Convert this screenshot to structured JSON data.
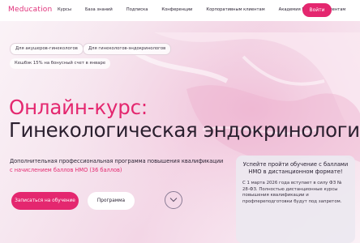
{
  "header": {
    "logo": "Meducation",
    "nav": [
      "Курсы",
      "База знаний",
      "Подписка",
      "Конференции",
      "Корпоративным клиентам",
      "Академия РТ",
      "Пациентам"
    ],
    "login_label": "Войти"
  },
  "tags": [
    "Для акушеров-гинекологов",
    "Для гинекологов-эндокринологов"
  ],
  "promo": "Кешбэк 15% на бонусный счет в январе",
  "hero": {
    "title_line1": "Онлайн-курс:",
    "title_line2": "Гинекологическая эндокринология",
    "subtitle": "Дополнительная профессиональная программа повышения квалификации",
    "subtitle_accent": "с начислением баллов НМО (36 баллов)"
  },
  "actions": {
    "enroll_label": "Записаться на обучение",
    "program_label": "Программа"
  },
  "notice": {
    "title": "Успейте пройти обучение с баллами НМО в дистанционном формате!",
    "body": "С 1 марта 2026 года вступает в силу ФЗ № 28-ФЗ. Полностью дистанционные курсы повышения квалификации и профпереподготовки будут под запретом."
  },
  "colors": {
    "accent": "#e4276f",
    "title_dark": "#2a1f2e",
    "notice_bg": "#ece8f0"
  },
  "icons": {
    "scroll": "chevron-down-icon"
  }
}
